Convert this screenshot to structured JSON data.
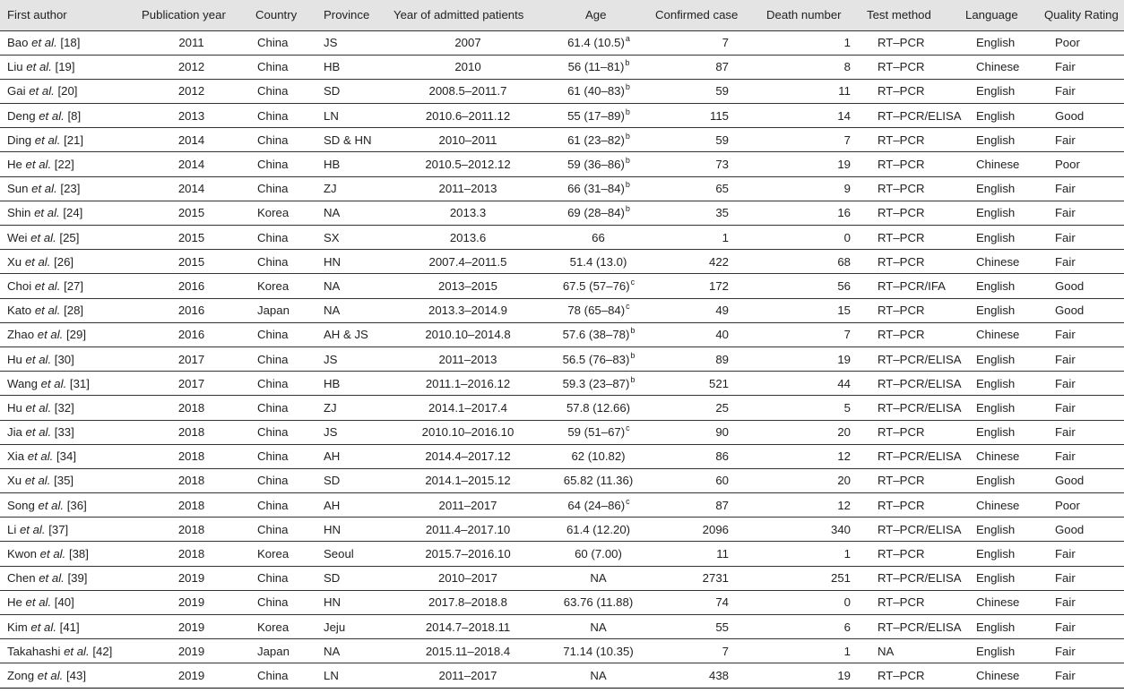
{
  "headers": [
    "First author",
    "Publication year",
    "Country",
    "Province",
    "Year of admitted patients",
    "Age",
    "Confirmed case",
    "Death number",
    "Test method",
    "Language",
    "Quality Rating"
  ],
  "rows": [
    {
      "name": "Bao",
      "etal": "et al.",
      "ref": "[18]",
      "year": "2011",
      "country": "China",
      "province": "JS",
      "admitted": "2007",
      "age": "61.4 (10.5)",
      "sup": "a",
      "confirmed": "7",
      "death": "1",
      "method": "RT–PCR",
      "language": "English",
      "quality": "Poor"
    },
    {
      "name": "Liu",
      "etal": "et al.",
      "ref": "[19]",
      "year": "2012",
      "country": "China",
      "province": "HB",
      "admitted": "2010",
      "age": "56 (11–81)",
      "sup": "b",
      "confirmed": "87",
      "death": "8",
      "method": "RT–PCR",
      "language": "Chinese",
      "quality": "Fair"
    },
    {
      "name": "Gai",
      "etal": "et al.",
      "ref": "[20]",
      "year": "2012",
      "country": "China",
      "province": "SD",
      "admitted": "2008.5–2011.7",
      "age": "61 (40–83)",
      "sup": "b",
      "confirmed": "59",
      "death": "11",
      "method": "RT–PCR",
      "language": "English",
      "quality": "Fair"
    },
    {
      "name": "Deng",
      "etal": "et al.",
      "ref": "[8]",
      "year": "2013",
      "country": "China",
      "province": "LN",
      "admitted": "2010.6–2011.12",
      "age": "55 (17–89)",
      "sup": "b",
      "confirmed": "115",
      "death": "14",
      "method": "RT–PCR/ELISA",
      "language": "English",
      "quality": "Good"
    },
    {
      "name": "Ding",
      "etal": "et al.",
      "ref": "[21]",
      "year": "2014",
      "country": "China",
      "province": "SD & HN",
      "admitted": "2010–2011",
      "age": "61 (23–82)",
      "sup": "b",
      "confirmed": "59",
      "death": "7",
      "method": "RT–PCR",
      "language": "English",
      "quality": "Fair"
    },
    {
      "name": "He",
      "etal": "et al.",
      "ref": "[22]",
      "year": "2014",
      "country": "China",
      "province": "HB",
      "admitted": "2010.5–2012.12",
      "age": "59 (36–86)",
      "sup": "b",
      "confirmed": "73",
      "death": "19",
      "method": "RT–PCR",
      "language": "Chinese",
      "quality": "Poor"
    },
    {
      "name": "Sun",
      "etal": "et al.",
      "ref": "[23]",
      "year": "2014",
      "country": "China",
      "province": "ZJ",
      "admitted": "2011–2013",
      "age": "66 (31–84)",
      "sup": "b",
      "confirmed": "65",
      "death": "9",
      "method": "RT–PCR",
      "language": "English",
      "quality": "Fair"
    },
    {
      "name": "Shin",
      "etal": "et al.",
      "ref": "[24]",
      "year": "2015",
      "country": "Korea",
      "province": "NA",
      "admitted": "2013.3",
      "age": "69 (28–84)",
      "sup": "b",
      "confirmed": "35",
      "death": "16",
      "method": "RT–PCR",
      "language": "English",
      "quality": "Fair"
    },
    {
      "name": "Wei",
      "etal": "et al.",
      "ref": "[25]",
      "year": "2015",
      "country": "China",
      "province": "SX",
      "admitted": "2013.6",
      "age": "66",
      "sup": "",
      "confirmed": "1",
      "death": "0",
      "method": "RT–PCR",
      "language": "English",
      "quality": "Fair"
    },
    {
      "name": "Xu",
      "etal": "et al.",
      "ref": "[26]",
      "year": "2015",
      "country": "China",
      "province": "HN",
      "admitted": "2007.4–2011.5",
      "age": "51.4 (13.0)",
      "sup": "",
      "confirmed": "422",
      "death": "68",
      "method": "RT–PCR",
      "language": "Chinese",
      "quality": "Fair"
    },
    {
      "name": "Choi",
      "etal": "et al.",
      "ref": "[27]",
      "year": "2016",
      "country": "Korea",
      "province": "NA",
      "admitted": "2013–2015",
      "age": "67.5 (57–76)",
      "sup": "c",
      "confirmed": "172",
      "death": "56",
      "method": "RT–PCR/IFA",
      "language": "English",
      "quality": "Good"
    },
    {
      "name": "Kato",
      "etal": "et al.",
      "ref": "[28]",
      "year": "2016",
      "country": "Japan",
      "province": "NA",
      "admitted": "2013.3–2014.9",
      "age": "78 (65–84)",
      "sup": "c",
      "confirmed": "49",
      "death": "15",
      "method": "RT–PCR",
      "language": "English",
      "quality": "Good"
    },
    {
      "name": "Zhao",
      "etal": "et al.",
      "ref": "[29]",
      "year": "2016",
      "country": "China",
      "province": "AH & JS",
      "admitted": "2010.10–2014.8",
      "age": "57.6 (38–78)",
      "sup": "b",
      "confirmed": "40",
      "death": "7",
      "method": "RT–PCR",
      "language": "Chinese",
      "quality": "Fair"
    },
    {
      "name": "Hu",
      "etal": "et al.",
      "ref": "[30]",
      "year": "2017",
      "country": "China",
      "province": "JS",
      "admitted": "2011–2013",
      "age": "56.5 (76–83)",
      "sup": "b",
      "confirmed": "89",
      "death": "19",
      "method": "RT–PCR/ELISA",
      "language": "English",
      "quality": "Fair"
    },
    {
      "name": "Wang",
      "etal": "et al.",
      "ref": "[31]",
      "year": "2017",
      "country": "China",
      "province": "HB",
      "admitted": "2011.1–2016.12",
      "age": "59.3 (23–87)",
      "sup": "b",
      "confirmed": "521",
      "death": "44",
      "method": "RT–PCR/ELISA",
      "language": "English",
      "quality": "Fair"
    },
    {
      "name": "Hu",
      "etal": "et al.",
      "ref": "[32]",
      "year": "2018",
      "country": "China",
      "province": "ZJ",
      "admitted": "2014.1–2017.4",
      "age": "57.8 (12.66)",
      "sup": "",
      "confirmed": "25",
      "death": "5",
      "method": "RT–PCR/ELISA",
      "language": "English",
      "quality": "Fair"
    },
    {
      "name": "Jia",
      "etal": "et al.",
      "ref": "[33]",
      "year": "2018",
      "country": "China",
      "province": "JS",
      "admitted": "2010.10–2016.10",
      "age": "59 (51–67)",
      "sup": "c",
      "confirmed": "90",
      "death": "20",
      "method": "RT–PCR",
      "language": "English",
      "quality": "Fair"
    },
    {
      "name": "Xia",
      "etal": "et al.",
      "ref": "[34]",
      "year": "2018",
      "country": "China",
      "province": "AH",
      "admitted": "2014.4–2017.12",
      "age": "62 (10.82)",
      "sup": "",
      "confirmed": "86",
      "death": "12",
      "method": "RT–PCR/ELISA",
      "language": "Chinese",
      "quality": "Fair"
    },
    {
      "name": "Xu",
      "etal": "et al.",
      "ref": "[35]",
      "year": "2018",
      "country": "China",
      "province": "SD",
      "admitted": "2014.1–2015.12",
      "age": "65.82 (11.36)",
      "sup": "",
      "confirmed": "60",
      "death": "20",
      "method": "RT–PCR",
      "language": "English",
      "quality": "Good"
    },
    {
      "name": "Song",
      "etal": "et al.",
      "ref": "[36]",
      "year": "2018",
      "country": "China",
      "province": "AH",
      "admitted": "2011–2017",
      "age": "64 (24–86)",
      "sup": "c",
      "confirmed": "87",
      "death": "12",
      "method": "RT–PCR",
      "language": "Chinese",
      "quality": "Poor"
    },
    {
      "name": "Li",
      "etal": "et al.",
      "ref": "[37]",
      "year": "2018",
      "country": "China",
      "province": "HN",
      "admitted": "2011.4–2017.10",
      "age": "61.4 (12.20)",
      "sup": "",
      "confirmed": "2096",
      "death": "340",
      "method": "RT–PCR/ELISA",
      "language": "English",
      "quality": "Good"
    },
    {
      "name": "Kwon",
      "etal": "et al.",
      "ref": "[38]",
      "year": "2018",
      "country": "Korea",
      "province": "Seoul",
      "admitted": "2015.7–2016.10",
      "age": "60 (7.00)",
      "sup": "",
      "confirmed": "11",
      "death": "1",
      "method": "RT–PCR",
      "language": "English",
      "quality": "Fair"
    },
    {
      "name": "Chen",
      "etal": "et al.",
      "ref": "[39]",
      "year": "2019",
      "country": "China",
      "province": "SD",
      "admitted": "2010–2017",
      "age": "NA",
      "sup": "",
      "confirmed": "2731",
      "death": "251",
      "method": "RT–PCR/ELISA",
      "language": "English",
      "quality": "Fair"
    },
    {
      "name": "He",
      "etal": "et al.",
      "ref": "[40]",
      "year": "2019",
      "country": "China",
      "province": "HN",
      "admitted": "2017.8–2018.8",
      "age": "63.76 (11.88)",
      "sup": "",
      "confirmed": "74",
      "death": "0",
      "method": "RT–PCR",
      "language": "Chinese",
      "quality": "Fair"
    },
    {
      "name": "Kim",
      "etal": "et al.",
      "ref": "[41]",
      "year": "2019",
      "country": "Korea",
      "province": "Jeju",
      "admitted": "2014.7–2018.11",
      "age": "NA",
      "sup": "",
      "confirmed": "55",
      "death": "6",
      "method": "RT–PCR/ELISA",
      "language": "English",
      "quality": "Fair"
    },
    {
      "name": "Takahashi",
      "etal": "et al.",
      "ref": "[42]",
      "year": "2019",
      "country": "Japan",
      "province": "NA",
      "admitted": "2015.11–2018.4",
      "age": "71.14 (10.35)",
      "sup": "",
      "confirmed": "7",
      "death": "1",
      "method": "NA",
      "language": "English",
      "quality": "Fair"
    },
    {
      "name": "Zong",
      "etal": "et al.",
      "ref": "[43]",
      "year": "2019",
      "country": "China",
      "province": "LN",
      "admitted": "2011–2017",
      "age": "NA",
      "sup": "",
      "confirmed": "438",
      "death": "19",
      "method": "RT–PCR",
      "language": "Chinese",
      "quality": "Fair"
    }
  ]
}
